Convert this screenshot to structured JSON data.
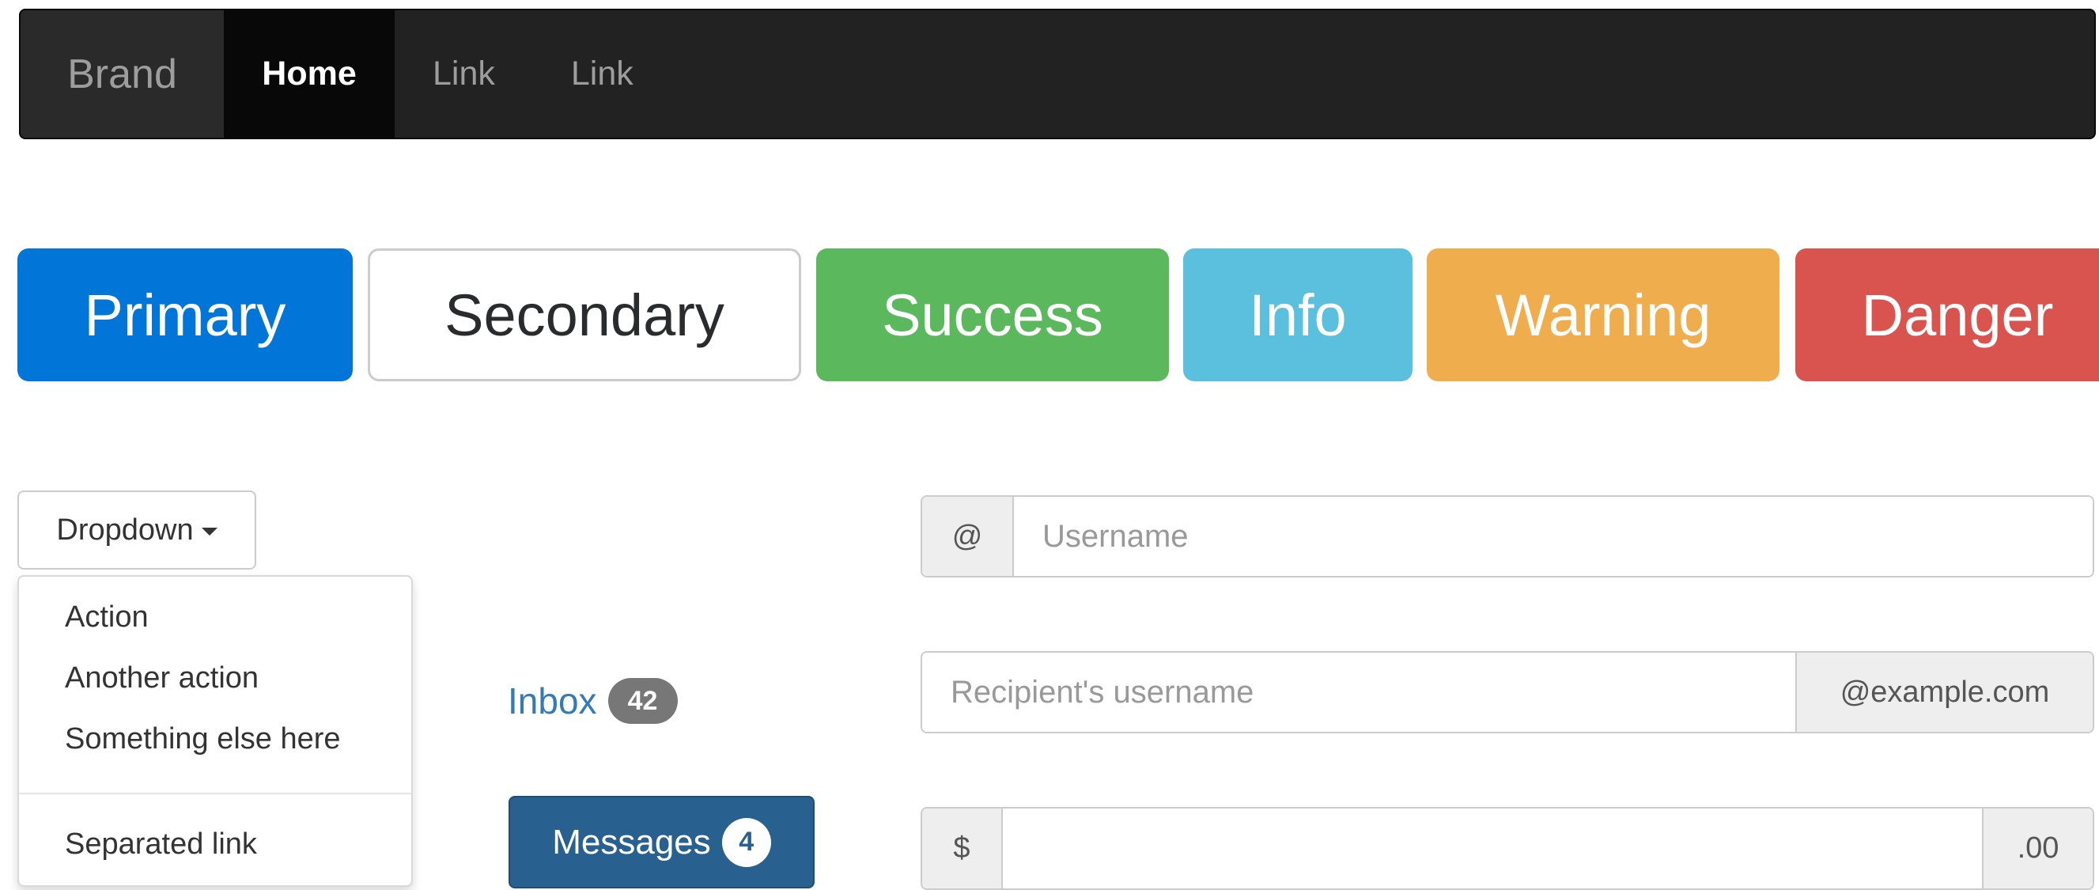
{
  "navbar": {
    "brand": "Brand",
    "items": [
      {
        "label": "Home",
        "active": true
      },
      {
        "label": "Link"
      },
      {
        "label": "Link"
      }
    ]
  },
  "buttons": {
    "primary": "Primary",
    "secondary": "Secondary",
    "success": "Success",
    "info": "Info",
    "warning": "Warning",
    "danger": "Danger"
  },
  "dropdown": {
    "toggle_label": "Dropdown",
    "items": [
      "Action",
      "Another action",
      "Something else here"
    ],
    "separated_item": "Separated link"
  },
  "inbox": {
    "label": "Inbox",
    "count": "42"
  },
  "messages": {
    "label": "Messages",
    "count": "4"
  },
  "input_groups": {
    "username": {
      "addon": "@",
      "placeholder": "Username"
    },
    "recipient": {
      "placeholder": "Recipient's username",
      "addon": "@example.com"
    },
    "amount": {
      "prefix": "$",
      "suffix": ".00",
      "value": ""
    }
  },
  "colors": {
    "primary": "#0275d8",
    "success": "#5cb85c",
    "info": "#5bc0de",
    "warning": "#f0ad4e",
    "danger": "#d9534f",
    "navbar_bg": "#222222",
    "link": "#337ab7",
    "messages_bg": "#286090"
  }
}
